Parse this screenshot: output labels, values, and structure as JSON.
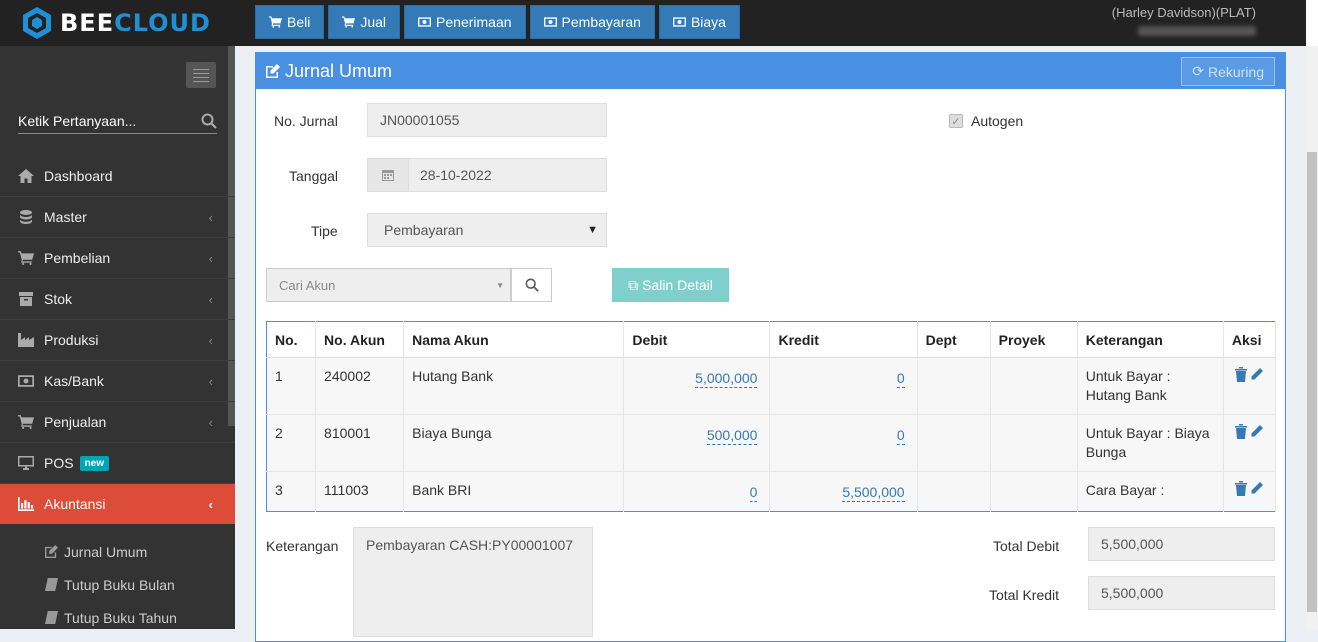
{
  "brand": {
    "part1": "BEE",
    "part2": "CLOUD"
  },
  "nav": {
    "buttons": [
      {
        "label": "Beli",
        "icon": "cart-icon"
      },
      {
        "label": "Jual",
        "icon": "cart-icon"
      },
      {
        "label": "Penerimaan",
        "icon": "money-icon"
      },
      {
        "label": "Pembayaran",
        "icon": "money-icon"
      },
      {
        "label": "Biaya",
        "icon": "money-icon"
      }
    ]
  },
  "user": {
    "company": "(Harley Davidson)(PLAT)"
  },
  "sidebar": {
    "search_placeholder": "Ketik Pertanyaan...",
    "items": [
      {
        "label": "Dashboard",
        "icon": "home-icon"
      },
      {
        "label": "Master",
        "icon": "database-icon"
      },
      {
        "label": "Pembelian",
        "icon": "cart-icon"
      },
      {
        "label": "Stok",
        "icon": "archive-icon"
      },
      {
        "label": "Produksi",
        "icon": "industry-icon"
      },
      {
        "label": "Kas/Bank",
        "icon": "money-icon"
      },
      {
        "label": "Penjualan",
        "icon": "cart-icon"
      },
      {
        "label": "POS",
        "icon": "monitor-icon",
        "badge": "new"
      },
      {
        "label": "Akuntansi",
        "icon": "bar-chart-icon"
      }
    ],
    "subitems": [
      {
        "label": "Jurnal Umum",
        "icon": "edit-icon"
      },
      {
        "label": "Tutup Buku Bulan",
        "icon": "book-icon"
      },
      {
        "label": "Tutup Buku Tahun",
        "icon": "book-icon"
      }
    ]
  },
  "panel": {
    "title": "Jurnal Umum",
    "rekuring_label": "Rekuring"
  },
  "form": {
    "no_jurnal_label": "No. Jurnal",
    "no_jurnal_value": "JN00001055",
    "autogen_label": "Autogen",
    "tanggal_label": "Tanggal",
    "tanggal_value": "28-10-2022",
    "tipe_label": "Tipe",
    "tipe_value": "Pembayaran",
    "cari_akun_placeholder": "Cari Akun",
    "salin_detail_label": "Salin Detail"
  },
  "table": {
    "headers": [
      "No.",
      "No. Akun",
      "Nama Akun",
      "Debit",
      "Kredit",
      "Dept",
      "Proyek",
      "Keterangan",
      "Aksi"
    ],
    "rows": [
      {
        "no": "1",
        "akun": "240002",
        "nama": "Hutang Bank",
        "debit": "5,000,000",
        "kredit": "0",
        "dept": "",
        "proyek": "",
        "ket": "Untuk Bayar : Hutang Bank"
      },
      {
        "no": "2",
        "akun": "810001",
        "nama": "Biaya Bunga",
        "debit": "500,000",
        "kredit": "0",
        "dept": "",
        "proyek": "",
        "ket": "Untuk Bayar : Biaya Bunga"
      },
      {
        "no": "3",
        "akun": "111003",
        "nama": "Bank BRI",
        "debit": "0",
        "kredit": "5,500,000",
        "dept": "",
        "proyek": "",
        "ket": "Cara Bayar :"
      }
    ]
  },
  "footer": {
    "keterangan_label": "Keterangan",
    "keterangan_value": "Pembayaran CASH:PY00001007",
    "total_debit_label": "Total Debit",
    "total_debit_value": "5,500,000",
    "total_kredit_label": "Total Kredit",
    "total_kredit_value": "5,500,000"
  }
}
